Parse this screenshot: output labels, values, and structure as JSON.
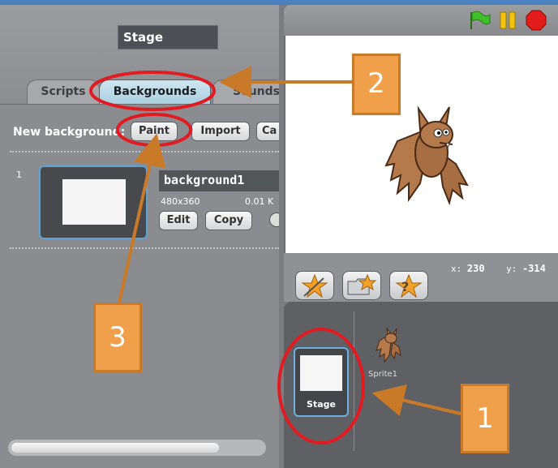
{
  "left": {
    "stage_name": "Stage",
    "tabs": [
      "Scripts",
      "Backgrounds",
      "Sounds"
    ],
    "new_background_label": "New background:",
    "buttons": {
      "paint": "Paint",
      "import": "Import",
      "camera": "Ca"
    },
    "background_item": {
      "index": "1",
      "name": "background1",
      "size": "480x360",
      "filesize": "0.01 K",
      "edit": "Edit",
      "copy": "Copy"
    }
  },
  "right": {
    "coords": {
      "x_label": "x:",
      "x": "230",
      "y_label": "y:",
      "y": "-314"
    },
    "stage_thumb_label": "Stage",
    "sprite_label": "Sprite1"
  },
  "annotations": {
    "one": "1",
    "two": "2",
    "three": "3"
  },
  "colors": {
    "highlight": "#e11b22",
    "callout": "#f0a04b",
    "arrow": "#c97a28"
  }
}
